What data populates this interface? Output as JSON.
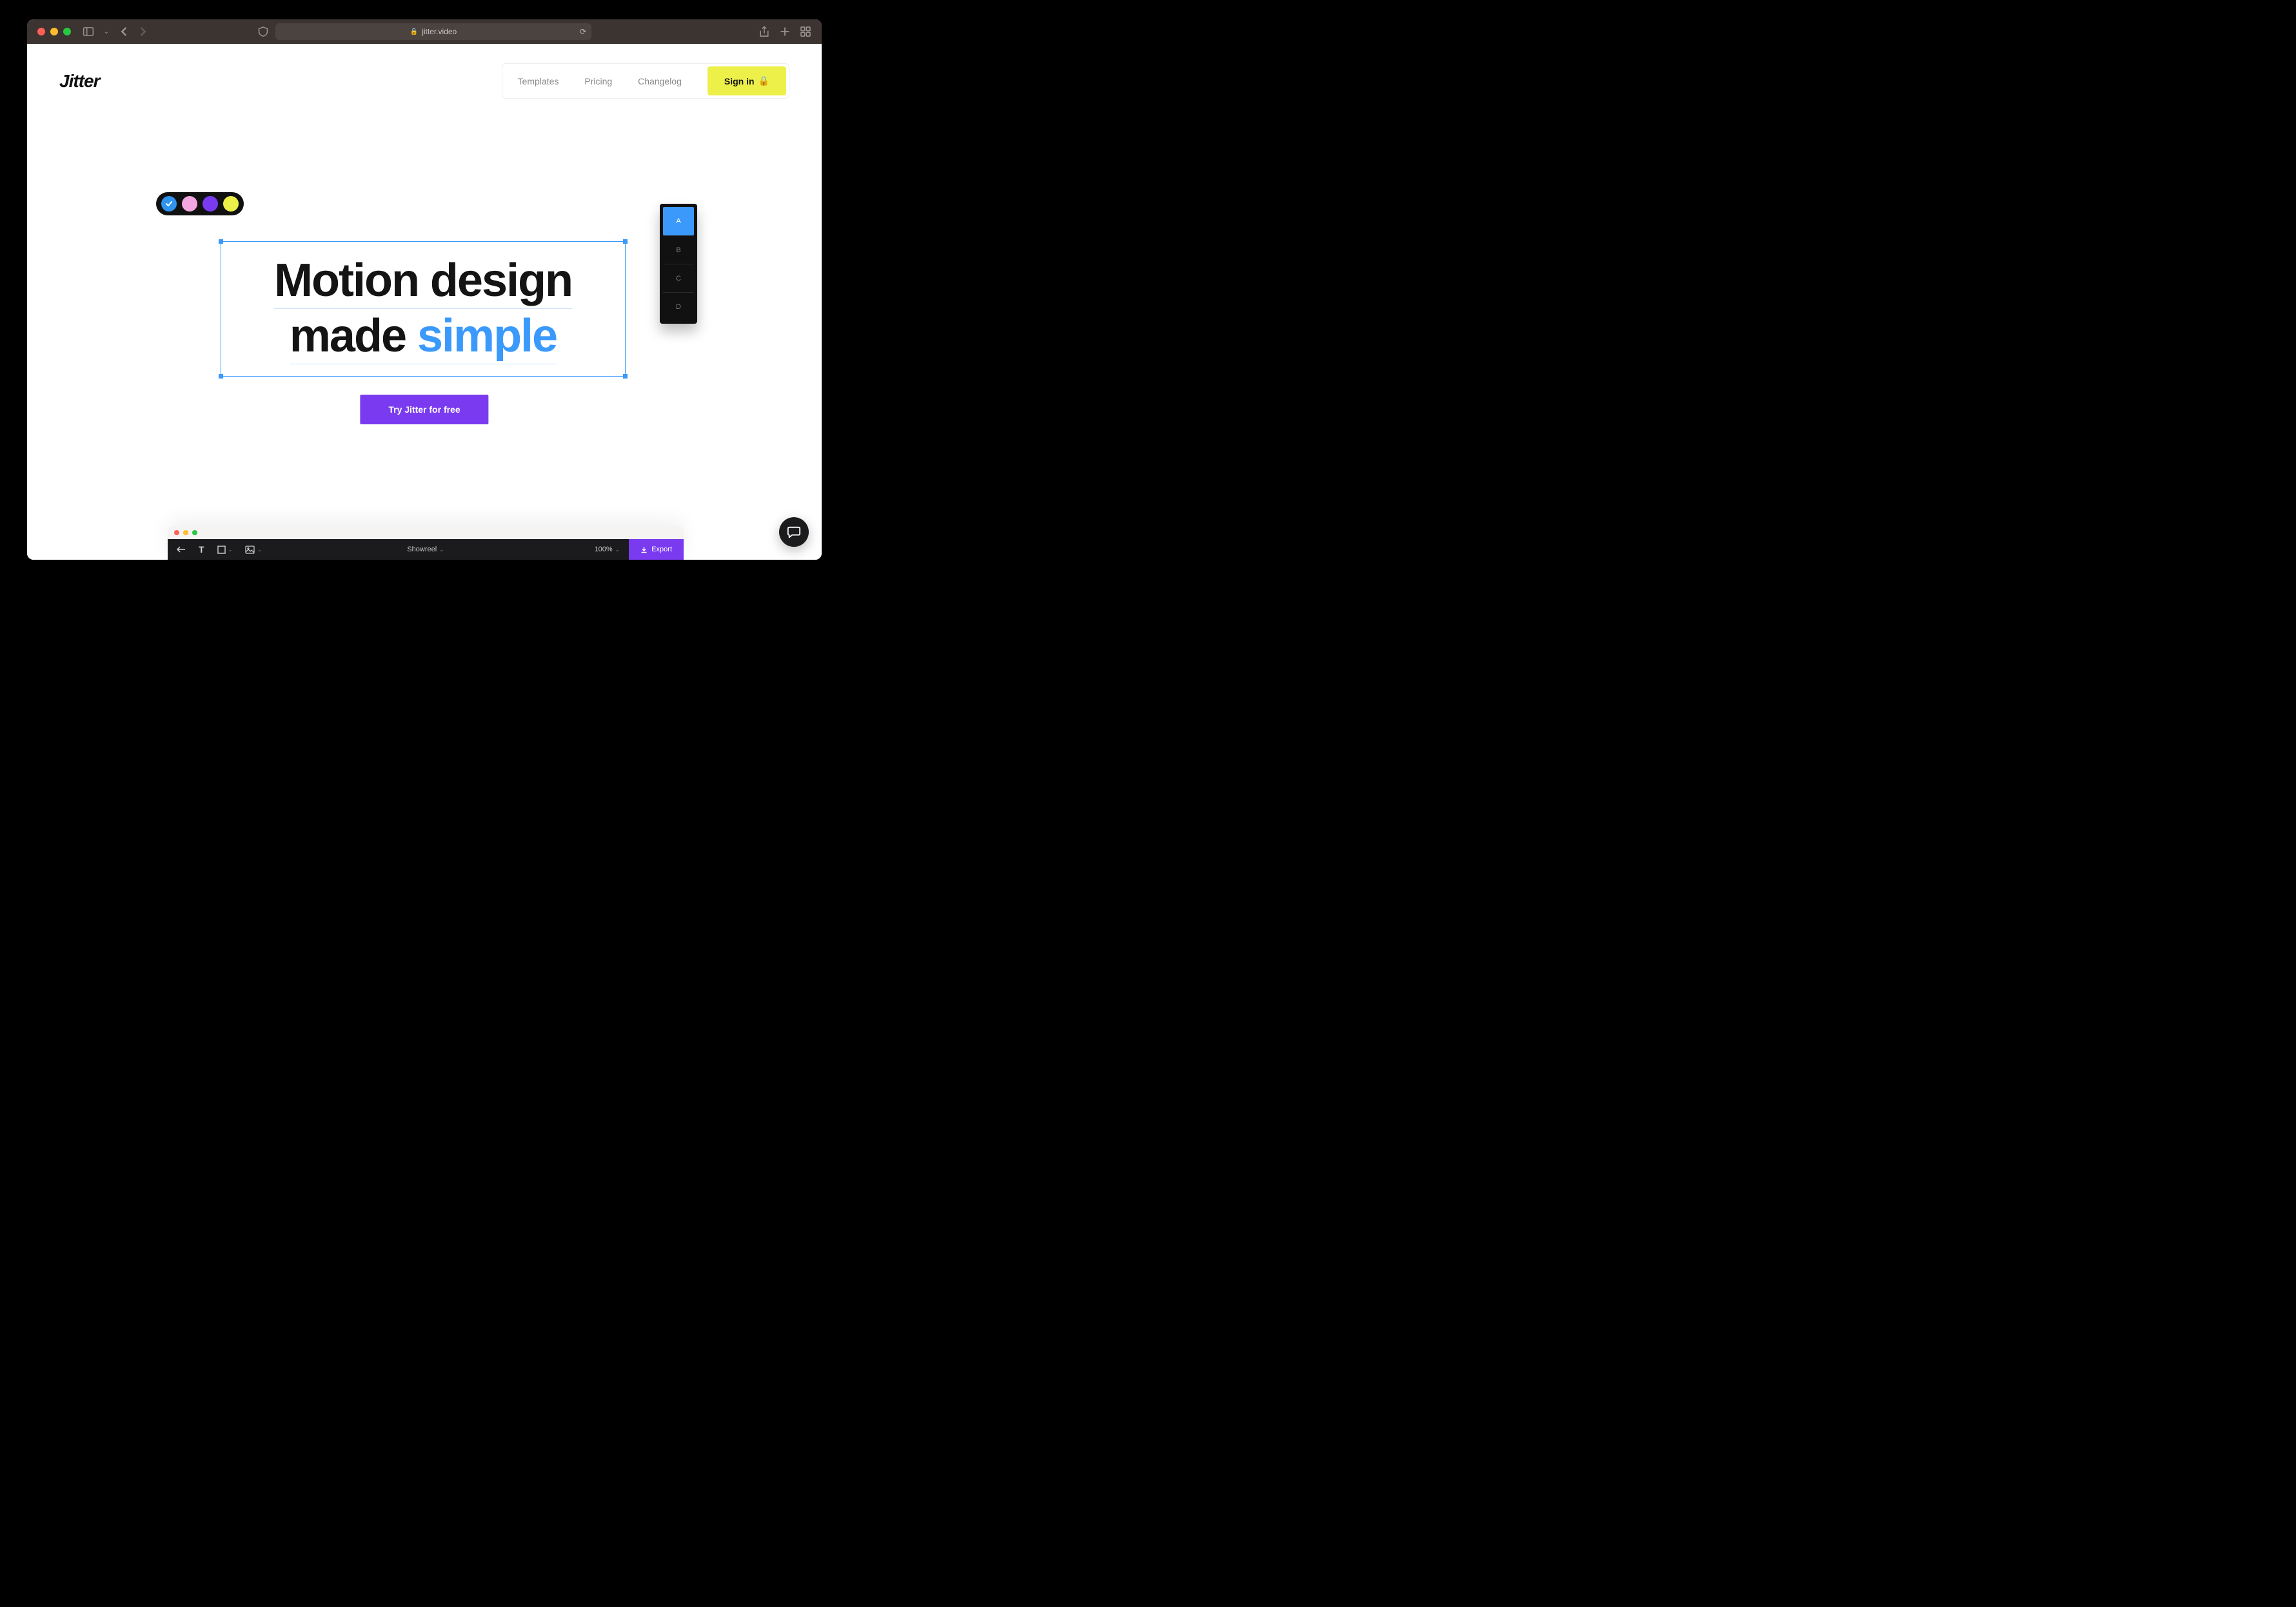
{
  "browser": {
    "url": "jitter.video"
  },
  "nav": {
    "logo": "Jitter",
    "links": [
      "Templates",
      "Pricing",
      "Changelog"
    ],
    "signin": "Sign in"
  },
  "palette": {
    "colors": [
      "#2f94f0",
      "#f2a7e0",
      "#7a3bf0",
      "#eef04a"
    ],
    "selected_index": 0
  },
  "hero": {
    "line1": "Motion design",
    "line2a": "made ",
    "line2b": "simple",
    "cta": "Try Jitter for free"
  },
  "variants": {
    "items": [
      "A",
      "B",
      "C",
      "D"
    ],
    "active_index": 0
  },
  "editor": {
    "title": "Showreel",
    "zoom": "100%",
    "export": "Export"
  }
}
